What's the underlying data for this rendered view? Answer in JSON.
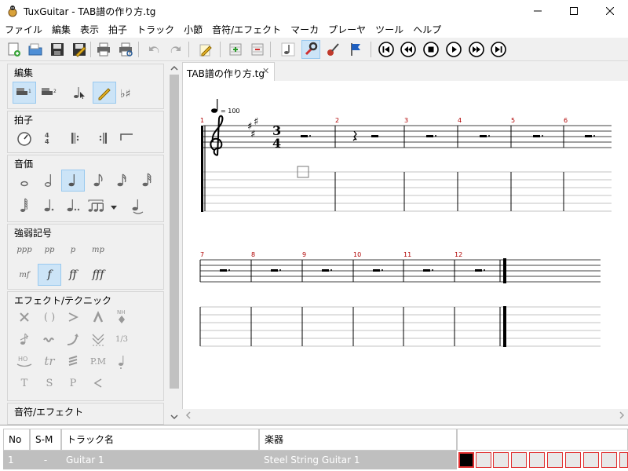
{
  "window": {
    "title": "TuxGuitar - TAB譜の作り方.tg"
  },
  "menu": [
    "ファイル",
    "編集",
    "表示",
    "拍子",
    "トラック",
    "小節",
    "音符/エフェクト",
    "マーカ",
    "プレーヤ",
    "ツール",
    "ヘルプ"
  ],
  "panel": {
    "groups": {
      "edit": "編集",
      "time": "拍子",
      "duration": "音価",
      "dynamics": "強弱記号",
      "effects": "エフェクト/テクニック",
      "note_effects": "音符/エフェクト"
    },
    "dynamics_row1": [
      "ppp",
      "pp",
      "p",
      "mp"
    ],
    "dynamics_row2": [
      "mf",
      "f",
      "ff",
      "fff"
    ],
    "fx_row1_mid": "( )",
    "fx_row2_text": "1/3",
    "fx_row3": [
      "HO",
      "tr",
      "P.M"
    ],
    "fx_row4": [
      "T",
      "S",
      "P"
    ]
  },
  "document": {
    "tab_label": "TAB譜の作り方.tg",
    "tempo": "= 100",
    "time_sig_top": "3",
    "time_sig_bottom": "4",
    "measures_row1": [
      "1",
      "2",
      "3",
      "4",
      "5",
      "6"
    ],
    "measures_row2": [
      "7",
      "8",
      "9",
      "10",
      "11",
      "12"
    ]
  },
  "tracks": {
    "headers": {
      "no": "No",
      "sm": "S-M",
      "name": "トラック名",
      "instrument": "楽器"
    },
    "rows": [
      {
        "no": "1",
        "sm": "-",
        "name": "Guitar 1",
        "instrument": "Steel String Guitar 1"
      }
    ]
  },
  "colors": {
    "selected": "#cce4f7",
    "measure_number": "#b00000",
    "track_box": "#e03030"
  }
}
